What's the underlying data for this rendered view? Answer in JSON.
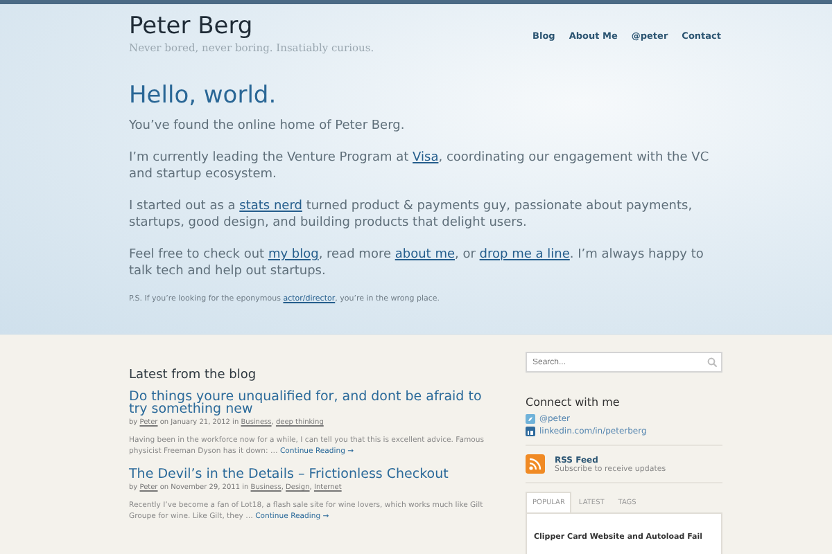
{
  "site": {
    "title": "Peter Berg",
    "tagline": "Never bored, never boring. Insatiably curious."
  },
  "nav": [
    {
      "label": "Blog"
    },
    {
      "label": "About Me"
    },
    {
      "label": "@peter"
    },
    {
      "label": "Contact"
    }
  ],
  "hero": {
    "heading": "Hello, world.",
    "paragraphs": [
      [
        {
          "kind": "text",
          "text": "You’ve found the online home of Peter Berg."
        }
      ],
      [
        {
          "kind": "text",
          "text": "I’m currently leading the Venture Program at "
        },
        {
          "kind": "link",
          "text": "Visa"
        },
        {
          "kind": "text",
          "text": ", coordinating our engagement with the VC and startup ecosystem."
        }
      ],
      [
        {
          "kind": "text",
          "text": "I started out as a "
        },
        {
          "kind": "link",
          "text": "stats nerd"
        },
        {
          "kind": "text",
          "text": " turned product & payments guy, passionate about payments, startups, good design, and building products that delight users."
        }
      ],
      [
        {
          "kind": "text",
          "text": "Feel free to check out "
        },
        {
          "kind": "link",
          "text": "my blog"
        },
        {
          "kind": "text",
          "text": ", read more "
        },
        {
          "kind": "link",
          "text": "about me"
        },
        {
          "kind": "text",
          "text": ", or "
        },
        {
          "kind": "link",
          "text": "drop me a line"
        },
        {
          "kind": "text",
          "text": ". I’m always happy to talk tech and help out startups."
        }
      ]
    ],
    "footnote": [
      {
        "kind": "text",
        "text": "P.S. If you’re looking for the eponymous "
      },
      {
        "kind": "link",
        "text": "actor/director"
      },
      {
        "kind": "text",
        "text": ", you’re in the wrong place."
      }
    ]
  },
  "blog": {
    "heading": "Latest from the blog",
    "posts": [
      {
        "title": "Do things youre unqualified for, and dont be afraid to try something new",
        "meta": [
          {
            "kind": "text",
            "text": "by "
          },
          {
            "kind": "link",
            "text": "Peter"
          },
          {
            "kind": "text",
            "text": " on January 21, 2012 in "
          },
          {
            "kind": "link",
            "text": "Business"
          },
          {
            "kind": "text",
            "text": ", "
          },
          {
            "kind": "link",
            "text": "deep thinking"
          }
        ],
        "excerpt": "Having been in the workforce now for a while, I can tell you that this is excellent advice. Famous physicist Freeman Dyson has it down: …",
        "more": "Continue Reading →"
      },
      {
        "title": "The Devil’s in the Details – Frictionless Checkout",
        "meta": [
          {
            "kind": "text",
            "text": "by "
          },
          {
            "kind": "link",
            "text": "Peter"
          },
          {
            "kind": "text",
            "text": " on November 29, 2011 in "
          },
          {
            "kind": "link",
            "text": "Business"
          },
          {
            "kind": "text",
            "text": ", "
          },
          {
            "kind": "link",
            "text": "Design"
          },
          {
            "kind": "text",
            "text": ", "
          },
          {
            "kind": "link",
            "text": "Internet"
          }
        ],
        "excerpt": "Recently I’ve become a fan of Lot18, a flash sale site for wine lovers, which works much like Gilt Groupe for wine. Like Gilt, they …",
        "more": "Continue Reading →"
      }
    ]
  },
  "sidebar": {
    "search": {
      "placeholder": "Search..."
    },
    "connect": {
      "heading": "Connect with me",
      "links": [
        {
          "kind": "twitter",
          "label": "@peter"
        },
        {
          "kind": "linkedin",
          "label": "linkedin.com/in/peterberg"
        }
      ]
    },
    "rss": {
      "title": "RSS Feed",
      "subtitle": "Subscribe to receive updates"
    },
    "tabs": [
      {
        "label": "POPULAR",
        "selected": true
      },
      {
        "label": "LATEST",
        "selected": false
      },
      {
        "label": "TAGS",
        "selected": false
      }
    ],
    "tab_items": [
      "Clipper Card Website and Autoload Fail"
    ]
  }
}
